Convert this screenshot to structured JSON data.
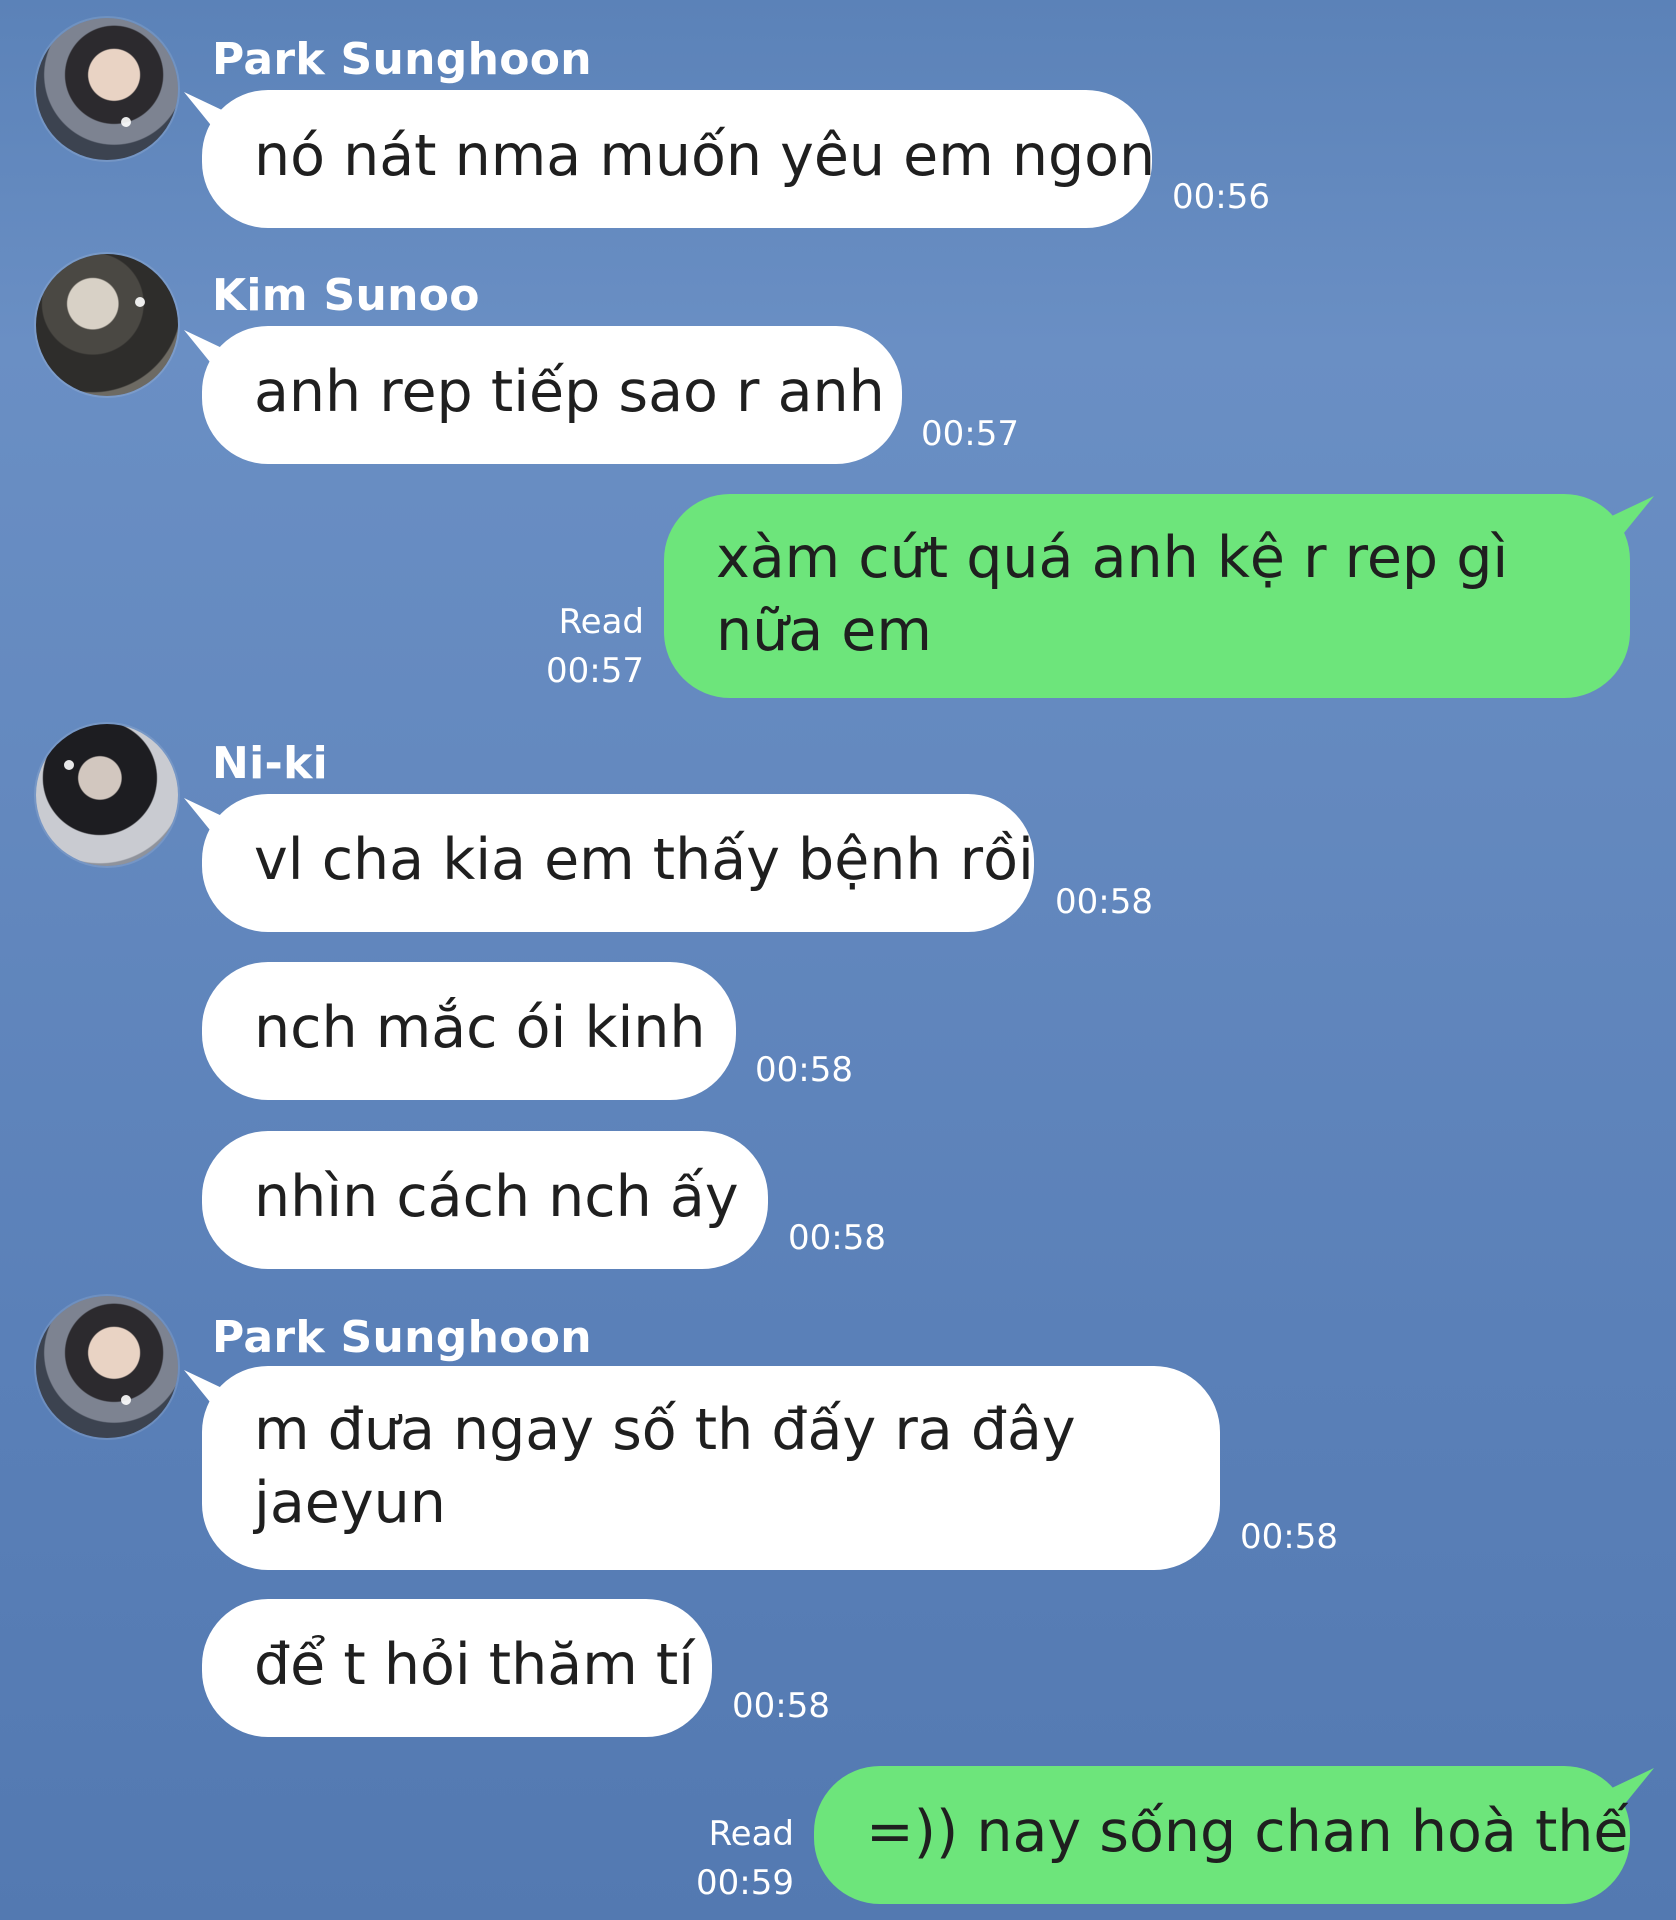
{
  "messages": [
    {
      "sender": "Park Sunghoon",
      "text": "nó nát nma muốn yêu em ngon",
      "time": "00:56"
    },
    {
      "sender": "Kim Sunoo",
      "text": "anh rep tiếp sao r anh",
      "time": "00:57"
    },
    {
      "sender": "me",
      "lines": [
        "xàm cứt quá anh kệ r rep gì",
        "nữa em"
      ],
      "status": "Read",
      "time": "00:57"
    },
    {
      "sender": "Ni-ki",
      "text": "vl cha kia em thấy bệnh rồi",
      "time": "00:58"
    },
    {
      "sender": "Ni-ki",
      "text": "nch mắc ói kinh",
      "time": "00:58"
    },
    {
      "sender": "Ni-ki",
      "text": "nhìn cách nch ấy",
      "time": "00:58"
    },
    {
      "sender": "Park Sunghoon",
      "lines": [
        "m đưa ngay số th đấy ra đây",
        "jaeyun"
      ],
      "time": "00:58"
    },
    {
      "sender": "Park Sunghoon",
      "text": "để t hỏi thăm tí",
      "time": "00:58"
    },
    {
      "sender": "me",
      "text": "=)) nay sống chan hoà thế",
      "status": "Read",
      "time": "00:59"
    }
  ],
  "colors": {
    "background": "#5b82b8",
    "incoming_bubble": "#ffffff",
    "outgoing_bubble": "#6de57b"
  }
}
